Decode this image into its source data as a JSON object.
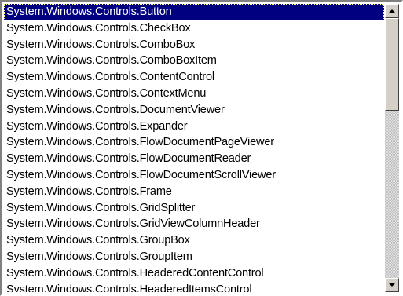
{
  "listbox": {
    "selected_index": 0,
    "items": [
      "System.Windows.Controls.Button",
      "System.Windows.Controls.CheckBox",
      "System.Windows.Controls.ComboBox",
      "System.Windows.Controls.ComboBoxItem",
      "System.Windows.Controls.ContentControl",
      "System.Windows.Controls.ContextMenu",
      "System.Windows.Controls.DocumentViewer",
      "System.Windows.Controls.Expander",
      "System.Windows.Controls.FlowDocumentPageViewer",
      "System.Windows.Controls.FlowDocumentReader",
      "System.Windows.Controls.FlowDocumentScrollViewer",
      "System.Windows.Controls.Frame",
      "System.Windows.Controls.GridSplitter",
      "System.Windows.Controls.GridViewColumnHeader",
      "System.Windows.Controls.GroupBox",
      "System.Windows.Controls.GroupItem",
      "System.Windows.Controls.HeaderedContentControl",
      "System.Windows.Controls.HeaderedItemsControl"
    ]
  },
  "scrollbar": {
    "up_icon": "arrow-up-icon",
    "down_icon": "arrow-down-icon",
    "position_fraction": 0.0
  },
  "colors": {
    "selection_background": "#000080",
    "selection_text": "#ffffff",
    "face": "#d4d0c8"
  }
}
